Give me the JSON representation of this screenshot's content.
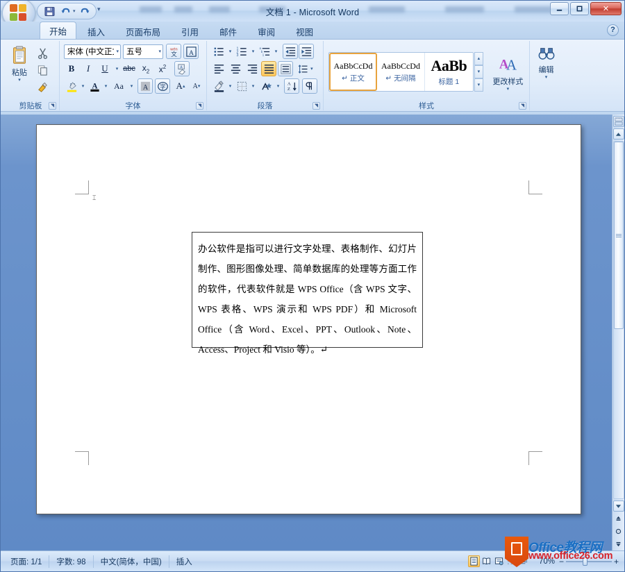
{
  "window": {
    "title": "文档 1 - Microsoft Word",
    "minimize_label": "—",
    "restore_label": "❐",
    "close_label": "✕"
  },
  "quick_access": {
    "office_button": "office-orb",
    "items": [
      {
        "name": "save",
        "icon": "save-icon"
      },
      {
        "name": "undo",
        "icon": "undo-icon"
      },
      {
        "name": "redo",
        "icon": "redo-icon"
      }
    ],
    "customize_label": "▾"
  },
  "ribbon": {
    "tabs": [
      {
        "label": "开始",
        "active": true
      },
      {
        "label": "插入",
        "active": false
      },
      {
        "label": "页面布局",
        "active": false
      },
      {
        "label": "引用",
        "active": false
      },
      {
        "label": "邮件",
        "active": false
      },
      {
        "label": "审阅",
        "active": false
      },
      {
        "label": "视图",
        "active": false
      }
    ],
    "help_label": "?",
    "groups": {
      "clipboard": {
        "label": "剪贴板",
        "paste_label": "粘贴",
        "paste_caret": "▾",
        "cut_icon": "scissors-icon",
        "copy_icon": "copy-icon",
        "format_painter_icon": "format-painter-icon",
        "launcher": "◥"
      },
      "font": {
        "label": "字体",
        "font_name": "宋体 (中文正文",
        "font_size": "五号",
        "caret": "▾",
        "phonetic_icon": "phonetic-guide-icon",
        "border_icon": "character-border-icon",
        "bold": "B",
        "italic": "I",
        "underline": "U",
        "strikethrough": "abc",
        "subscript": "x₂",
        "superscript": "x²",
        "clear_format_icon": "clear-formatting-icon",
        "highlight": "ab",
        "font_color": "A",
        "change_case": "Aa",
        "shading": "A",
        "enclose": "字",
        "grow_font": "A",
        "shrink_font": "A",
        "launcher": "◥"
      },
      "paragraph": {
        "label": "段落",
        "bullets_icon": "bullet-list-icon",
        "numbering_icon": "numbered-list-icon",
        "multilevel_icon": "multilevel-list-icon",
        "decrease_indent_icon": "decrease-indent-icon",
        "increase_indent_icon": "increase-indent-icon",
        "align_left_icon": "align-left-icon",
        "align_center_icon": "align-center-icon",
        "align_right_icon": "align-right-icon",
        "justify_icon": "justify-icon",
        "distribute_icon": "distribute-icon",
        "line_spacing_icon": "line-spacing-icon",
        "shading_icon": "paragraph-shading-icon",
        "borders_icon": "borders-icon",
        "sort_icon": "sort-icon",
        "show_marks_icon": "show-formatting-marks-icon",
        "launcher": "◥"
      },
      "styles": {
        "label": "样式",
        "items": [
          {
            "preview": "AaBbCcDd",
            "name": "正文",
            "mark": "↵",
            "selected": true
          },
          {
            "preview": "AaBbCcDd",
            "name": "无间隔",
            "mark": "↵",
            "selected": false
          },
          {
            "preview": "AaBb",
            "name": "标题 1",
            "mark": "",
            "selected": false
          }
        ],
        "nav_up": "▴",
        "nav_down": "▾",
        "nav_more": "▾",
        "change_styles_label": "更改样式",
        "change_styles_caret": "▾",
        "launcher": "◥"
      },
      "editing": {
        "label": "编辑",
        "button_label": "编辑",
        "caret": "▾",
        "icon": "binoculars-icon"
      }
    }
  },
  "document": {
    "paragraph": "办公软件是指可以进行文字处理、表格制作、幻灯片制作、图形图像处理、简单数据库的处理等方面工作的软件，代表软件就是 WPS Office（含 WPS 文字、WPS 表格、WPS 演示和 WPS PDF）和 Microsoft Office（含 Word、Excel、PPT、Outlook、Note、Access、Project 和 Visio 等）。↵",
    "cursor_mark": "⌶"
  },
  "scrollbar": {
    "ruler_toggle_icon": "ruler-toggle-icon",
    "up_arrow": "▲",
    "down_arrow": "▼",
    "prev_page": "⬓",
    "browse_object": "◉",
    "next_page": "⬒"
  },
  "status_bar": {
    "page": "页面: 1/1",
    "words": "字数: 98",
    "language": "中文(简体，中国)",
    "mode": "插入",
    "views": [
      {
        "name": "print-layout-view",
        "icon": "print-layout-icon",
        "active": true
      },
      {
        "name": "full-screen-reading-view",
        "icon": "reading-view-icon",
        "active": false
      },
      {
        "name": "web-layout-view",
        "icon": "web-layout-icon",
        "active": false
      },
      {
        "name": "outline-view",
        "icon": "outline-view-icon",
        "active": false
      },
      {
        "name": "draft-view",
        "icon": "draft-view-icon",
        "active": false
      }
    ],
    "zoom": "70%",
    "zoom_out": "−",
    "zoom_in": "+"
  },
  "watermark": {
    "badge": "office-logo",
    "title": "Office教程网",
    "url": "www.office26.com"
  }
}
